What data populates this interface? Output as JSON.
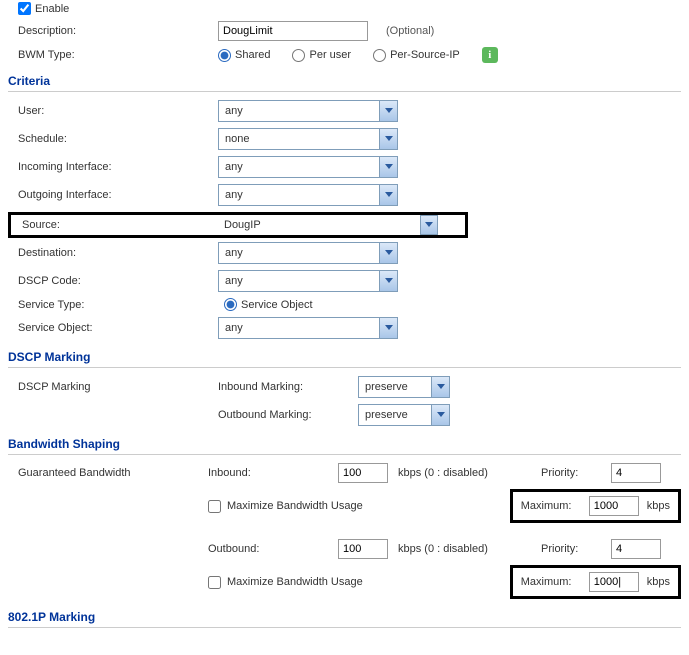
{
  "top": {
    "enable_label": "Enable",
    "description_label": "Description:",
    "description_value": "DougLimit",
    "optional_text": "(Optional)",
    "bwm_type_label": "BWM Type:",
    "bwm_shared": "Shared",
    "bwm_peruser": "Per user",
    "bwm_persource": "Per-Source-IP"
  },
  "criteria": {
    "header": "Criteria",
    "user_label": "User:",
    "user_value": "any",
    "schedule_label": "Schedule:",
    "schedule_value": "none",
    "incoming_label": "Incoming Interface:",
    "incoming_value": "any",
    "outgoing_label": "Outgoing Interface:",
    "outgoing_value": "any",
    "source_label": "Source:",
    "source_value": "DougIP",
    "destination_label": "Destination:",
    "destination_value": "any",
    "dscp_label": "DSCP Code:",
    "dscp_value": "any",
    "service_type_label": "Service Type:",
    "service_type_option": "Service Object",
    "service_object_label": "Service Object:",
    "service_object_value": "any"
  },
  "dscp_marking": {
    "header": "DSCP Marking",
    "label": "DSCP Marking",
    "inbound_label": "Inbound Marking:",
    "inbound_value": "preserve",
    "outbound_label": "Outbound Marking:",
    "outbound_value": "preserve"
  },
  "bandwidth": {
    "header": "Bandwidth Shaping",
    "guaranteed_label": "Guaranteed Bandwidth",
    "inbound_label": "Inbound:",
    "inbound_value": "100",
    "outbound_label": "Outbound:",
    "outbound_value": "100",
    "kbps_disabled": "kbps (0 : disabled)",
    "maximize_label": "Maximize Bandwidth Usage",
    "priority_label": "Priority:",
    "priority_in": "4",
    "priority_out": "4",
    "maximum_label": "Maximum:",
    "max_in": "1000",
    "max_out": "1000|",
    "kbps": "kbps"
  },
  "p8021": {
    "header": "802.1P Marking"
  }
}
